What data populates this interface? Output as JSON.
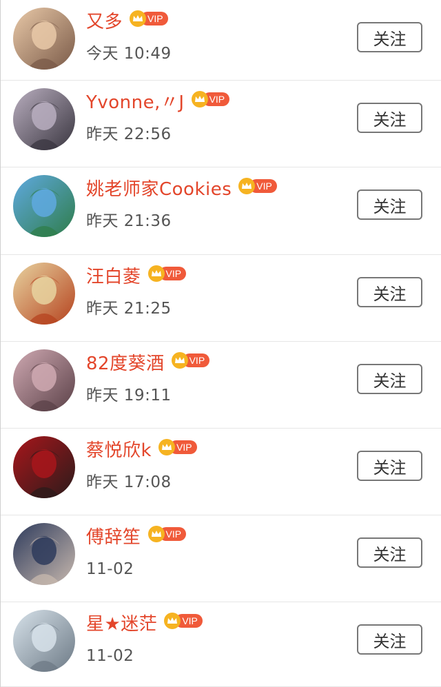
{
  "vip_label": "VIP",
  "follow_label": "关注",
  "colors": {
    "name": "#e3462b",
    "vip_badge": "#f05a3a",
    "crown": "#f6b321",
    "time": "#555555",
    "button_border": "#777777"
  },
  "users": [
    {
      "name": "又多",
      "time": "今天 10:49",
      "avatar_icon": "avatar-girl-blonde-icon",
      "avatar_colors": [
        "#e9c9a8",
        "#7a5a48"
      ]
    },
    {
      "name": "Yvonne,〃J",
      "time": "昨天 22:56",
      "avatar_icon": "avatar-drawn-face-icon",
      "avatar_colors": [
        "#b9aebf",
        "#3a3640"
      ]
    },
    {
      "name": "姚老师家Cookies",
      "time": "昨天 21:36",
      "avatar_icon": "avatar-anime-sky-icon",
      "avatar_colors": [
        "#5fa9e0",
        "#2f7d4a"
      ]
    },
    {
      "name": "汪白菱",
      "time": "昨天 21:25",
      "avatar_icon": "avatar-cartoon-girl-icon",
      "avatar_colors": [
        "#e8d3a0",
        "#b5431f"
      ]
    },
    {
      "name": "82度葵酒",
      "time": "昨天 19:11",
      "avatar_icon": "avatar-sketch-face-icon",
      "avatar_colors": [
        "#cfa9b2",
        "#5b4148"
      ]
    },
    {
      "name": "蔡悦欣k",
      "time": "昨天 17:08",
      "avatar_icon": "avatar-red-man-icon",
      "avatar_colors": [
        "#a8161b",
        "#2b1b1b"
      ]
    },
    {
      "name": "傅辞笙",
      "time": "11-02",
      "avatar_icon": "avatar-dark-man-icon",
      "avatar_colors": [
        "#2e3b5c",
        "#c7b8ae"
      ]
    },
    {
      "name": "星★迷茫",
      "time": "11-02",
      "avatar_icon": "avatar-boy-light-icon",
      "avatar_colors": [
        "#d7e2ea",
        "#6d7a86"
      ]
    }
  ]
}
